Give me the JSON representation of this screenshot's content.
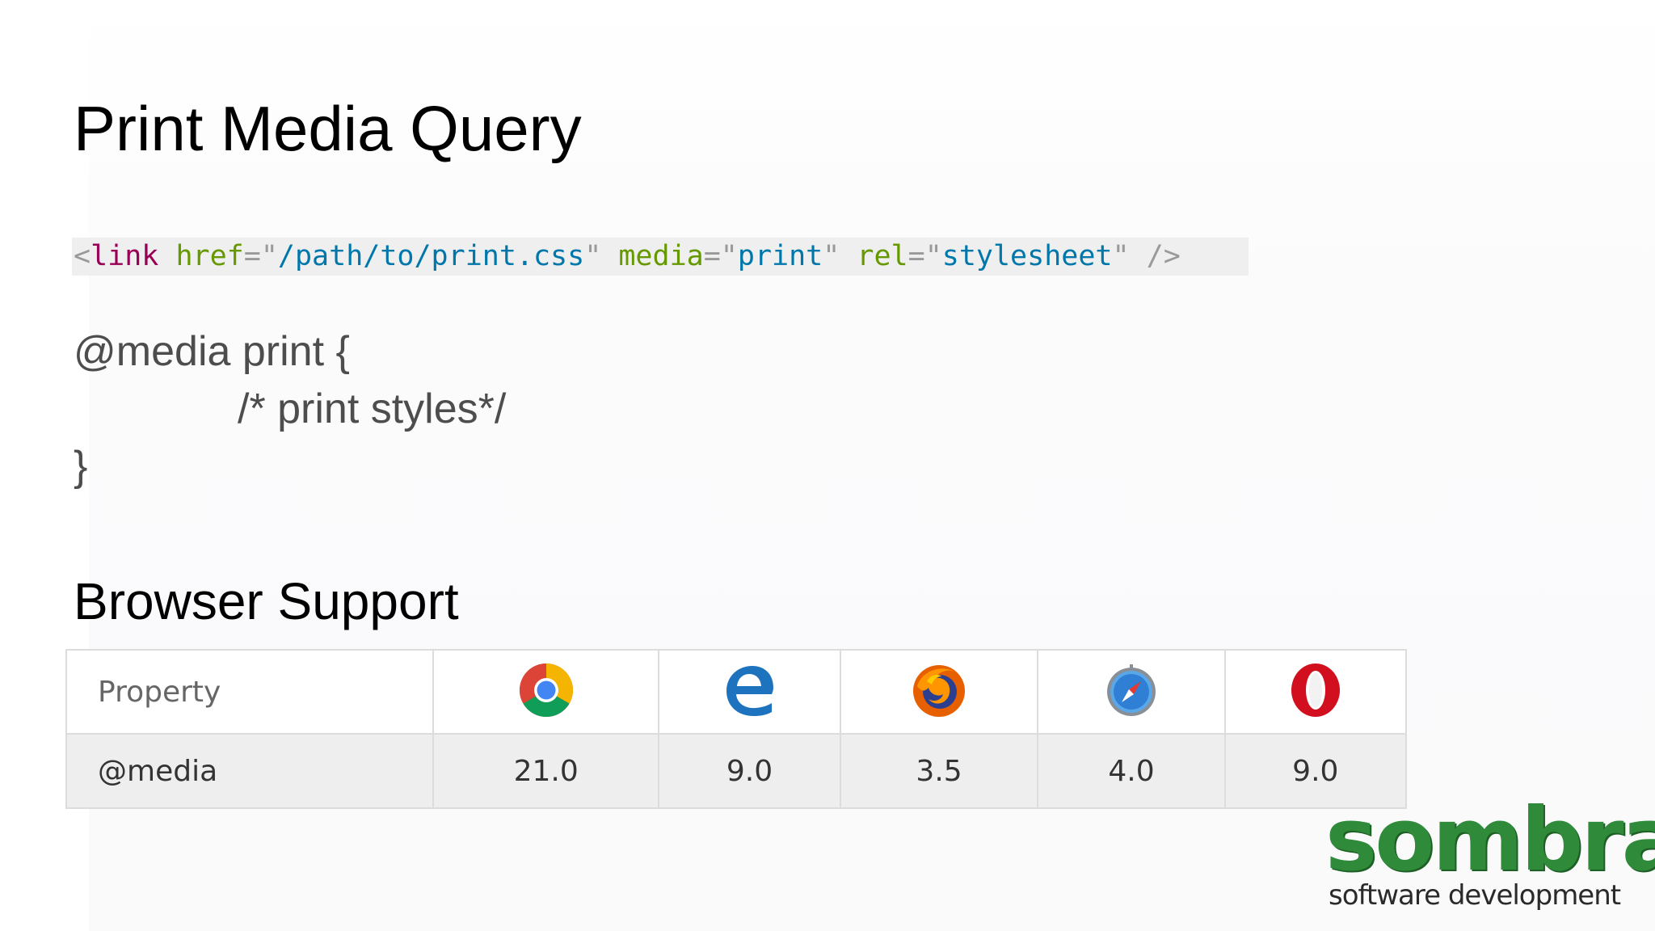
{
  "slide": {
    "title": "Print Media Query",
    "section_title": "Browser Support"
  },
  "code": {
    "open_bracket": "<",
    "tag": "link",
    "attr_href": "href",
    "eq": "=",
    "quote": "\"",
    "val_href": "/path/to/print.css",
    "attr_media": "media",
    "val_media": "print",
    "attr_rel": "rel",
    "val_rel": "stylesheet",
    "close": "/>"
  },
  "css_block": {
    "line1": "@media print {",
    "line2": "/* print styles*/",
    "line3": "}"
  },
  "support_table": {
    "header_label": "Property",
    "browsers": [
      {
        "icon": "chrome-icon"
      },
      {
        "icon": "edge-icon"
      },
      {
        "icon": "firefox-icon"
      },
      {
        "icon": "safari-icon"
      },
      {
        "icon": "opera-icon"
      }
    ],
    "row_label": "@media",
    "values": [
      "21.0",
      "9.0",
      "3.5",
      "4.0",
      "9.0"
    ]
  },
  "logo": {
    "word": "sombra",
    "tagline": "software development",
    "color": "#2f8a3a"
  }
}
